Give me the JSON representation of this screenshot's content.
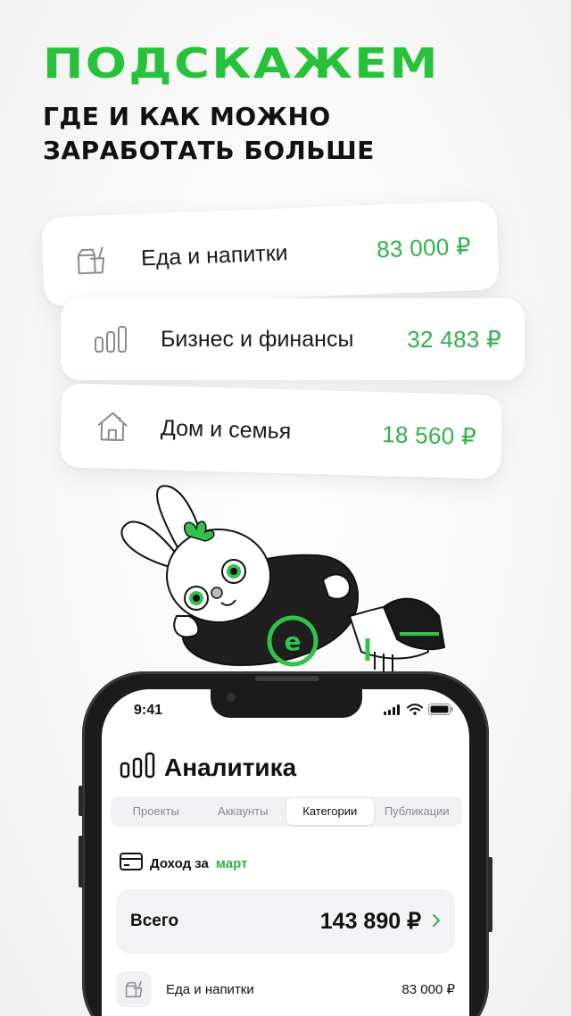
{
  "headline": "ПОДСКАЖЕМ",
  "subheadline": "ГДЕ И КАК МОЖНО ЗАРАБОТАТЬ БОЛЬШЕ",
  "promo_cards": [
    {
      "label": "Еда и напитки",
      "amount": "83 000 ₽",
      "icon": "food-drink-icon"
    },
    {
      "label": "Бизнес и финансы",
      "amount": "32 483 ₽",
      "icon": "bar-chart-icon"
    },
    {
      "label": "Дом и семья",
      "amount": "18 560 ₽",
      "icon": "house-icon"
    }
  ],
  "phone": {
    "status_time": "9:41",
    "page_title": "Аналитика",
    "tabs": [
      "Проекты",
      "Аккаунты",
      "Категории",
      "Публикации"
    ],
    "active_tab": "Категории",
    "income_label": "Доход за",
    "income_month": "март",
    "total_label": "Всего",
    "total_value": "143 890 ₽",
    "list": [
      {
        "label": "Еда и напитки",
        "value": "83 000 ₽",
        "icon": "food-drink-icon"
      }
    ]
  },
  "colors": {
    "accent_green": "#27c23a",
    "amount_green": "#2fb34a",
    "text_dark": "#111111"
  }
}
